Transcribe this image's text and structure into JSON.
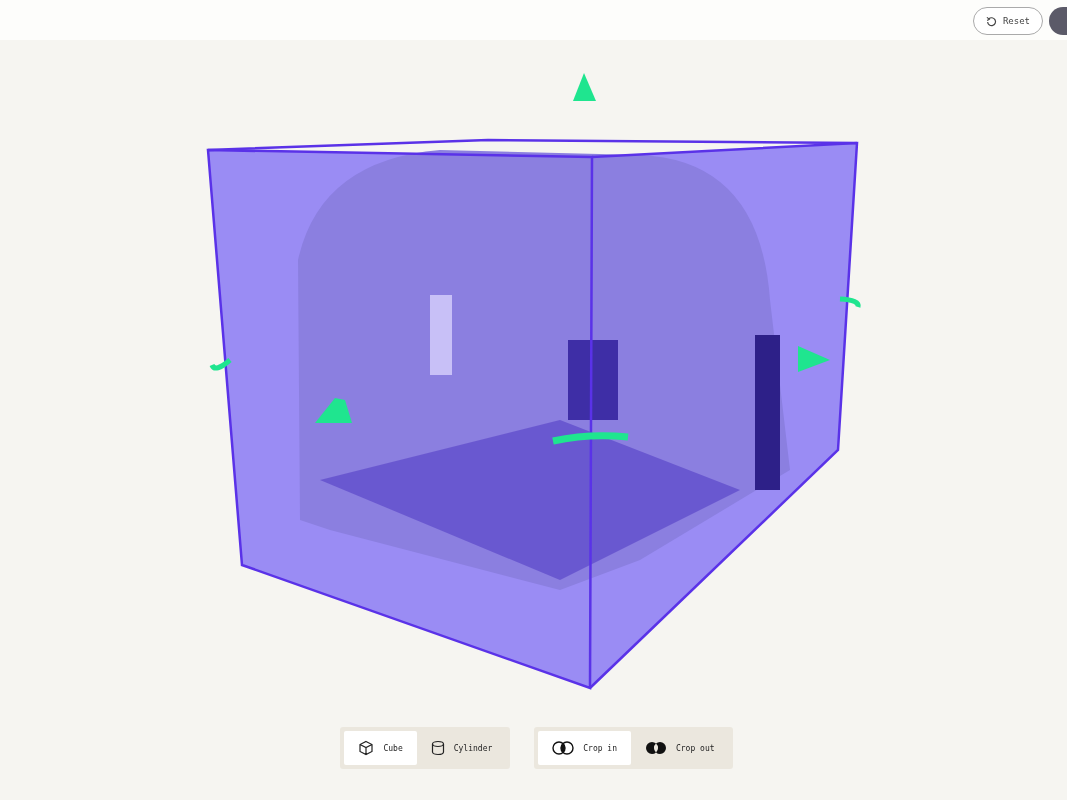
{
  "top_bar": {
    "reset_button": {
      "label": "Reset"
    }
  },
  "shape_toggle": [
    {
      "label": "Cube",
      "kind": "cube",
      "selected": true
    },
    {
      "label": "Cylinder",
      "kind": "cylinder",
      "selected": false
    }
  ],
  "crop_toggle": [
    {
      "label": "Crop in",
      "kind": "crop-in",
      "selected": true
    },
    {
      "label": "Crop out",
      "kind": "crop-out",
      "selected": false
    }
  ]
}
